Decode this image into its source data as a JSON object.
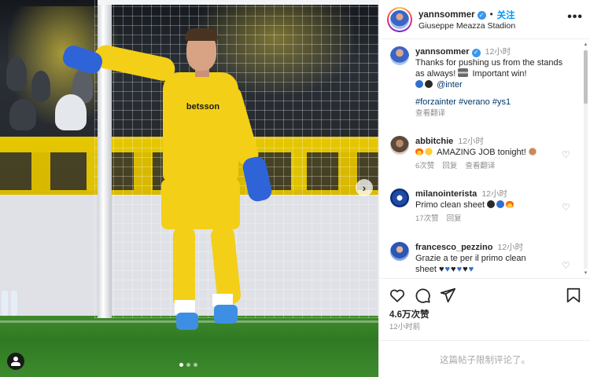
{
  "header": {
    "username": "yannsommer",
    "separator": "•",
    "follow_label": "关注",
    "location": "Giuseppe Meazza Stadion",
    "more_label": "•••"
  },
  "photo": {
    "jersey_sponsor": "betsson",
    "next_arrow": "›",
    "slide_count": 3,
    "active_slide": 1
  },
  "caption": {
    "username": "yannsommer",
    "time": "12小时",
    "text_1": "Thanks for pushing us from the stands as always!",
    "text_2": "Important win!",
    "mention": "@inter",
    "hashtags": "#forzainter #verano #ys1",
    "translate": "查看翻译"
  },
  "comments": [
    {
      "username": "abbitchie",
      "time": "12小时",
      "text": "AMAZING JOB tonight!",
      "likes": "6次赞",
      "reply": "回复",
      "translate": "查看翻译"
    },
    {
      "username": "milanointerista",
      "time": "12小时",
      "text": "Primo clean sheet",
      "likes": "17次赞",
      "reply": "回复"
    },
    {
      "username": "francesco_pezzino",
      "time": "12小时",
      "text_1": "Grazie a te per il primo clean",
      "text_2": "sheet"
    }
  ],
  "footer": {
    "likes": "4.6万次赞",
    "time": "12小时前",
    "comments_limited": "这篇帖子限制评论了。"
  },
  "icons": {
    "like": "heart-icon",
    "comment": "comment-icon",
    "share": "paper-plane-icon",
    "save": "bookmark-icon"
  },
  "colors": {
    "link_blue": "#0095f6",
    "verified_blue": "#3897f0",
    "hashtag": "#00376b",
    "muted": "#8e8e8e"
  }
}
